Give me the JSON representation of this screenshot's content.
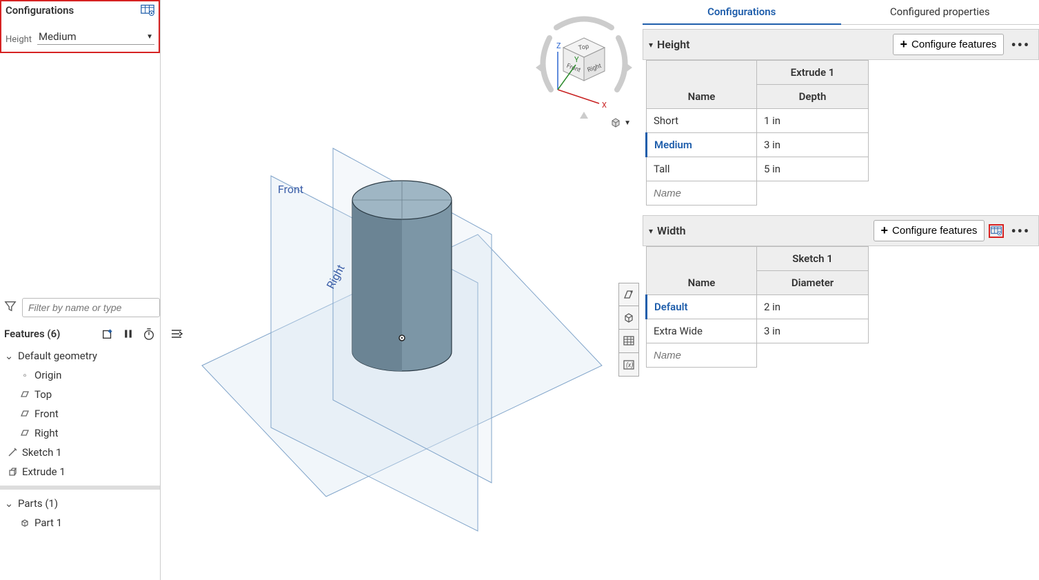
{
  "left": {
    "configurations_title": "Configurations",
    "height_label": "Height",
    "height_value": "Medium",
    "filter_placeholder": "Filter by name or type",
    "features_title": "Features (6)",
    "default_geometry": "Default geometry",
    "origin": "Origin",
    "top": "Top",
    "front": "Front",
    "right": "Right",
    "sketch1": "Sketch 1",
    "extrude1": "Extrude 1",
    "parts_title": "Parts (1)",
    "part1": "Part 1"
  },
  "viewport": {
    "front_label": "Front",
    "right_label": "Right",
    "cube_top": "Top",
    "cube_front": "Front",
    "cube_right": "Right",
    "axis_x": "X",
    "axis_y": "Y",
    "axis_z": "Z"
  },
  "right": {
    "tab_configurations": "Configurations",
    "tab_configured_properties": "Configured properties",
    "configure_features_btn": "Configure features",
    "height": {
      "title": "Height",
      "col_name": "Name",
      "col_group": "Extrude 1",
      "col_depth": "Depth",
      "rows": [
        {
          "name": "Short",
          "depth": "1 in"
        },
        {
          "name": "Medium",
          "depth": "3 in"
        },
        {
          "name": "Tall",
          "depth": "5 in"
        }
      ],
      "placeholder": "Name"
    },
    "width": {
      "title": "Width",
      "col_name": "Name",
      "col_group": "Sketch 1",
      "col_diameter": "Diameter",
      "rows": [
        {
          "name": "Default",
          "diameter": "2 in"
        },
        {
          "name": "Extra Wide",
          "diameter": "3 in"
        }
      ],
      "placeholder": "Name"
    }
  }
}
